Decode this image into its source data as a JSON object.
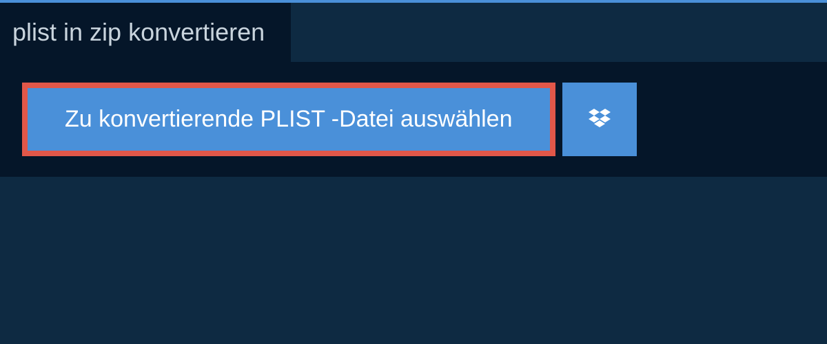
{
  "header": {
    "title": "plist in zip konvertieren"
  },
  "buttons": {
    "select_file_label": "Zu konvertierende PLIST -Datei auswählen"
  },
  "colors": {
    "accent": "#4a90d9",
    "highlight_border": "#e25749",
    "background_dark": "#051629",
    "background_page": "#0e2a42"
  }
}
